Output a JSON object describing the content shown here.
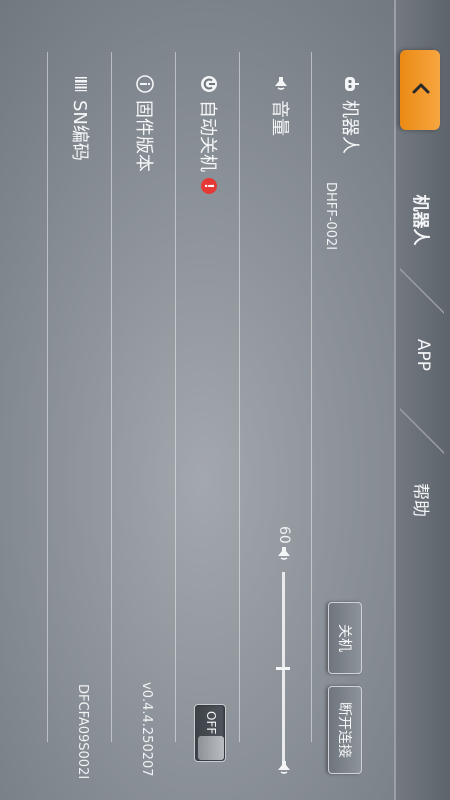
{
  "header": {
    "tabs": [
      {
        "label": "机器人",
        "active": true
      },
      {
        "label": "APP",
        "active": false
      },
      {
        "label": "帮助",
        "active": false
      }
    ]
  },
  "settings": {
    "robot": {
      "label": "机器人",
      "value": "DHFF-002I",
      "shutdown_button": "关机",
      "disconnect_button": "断开连接"
    },
    "volume": {
      "label": "音量",
      "value": "60"
    },
    "auto_shutdown": {
      "label": "自动关机",
      "badge": "!",
      "toggle_label": "OFF"
    },
    "firmware": {
      "label": "固件版本",
      "value": "v0.4.4.250207"
    },
    "sn": {
      "label": "SN编码",
      "value": "DFCFA09S002I"
    }
  },
  "colors": {
    "accent": "#f39a2a",
    "badge": "#e53935"
  }
}
